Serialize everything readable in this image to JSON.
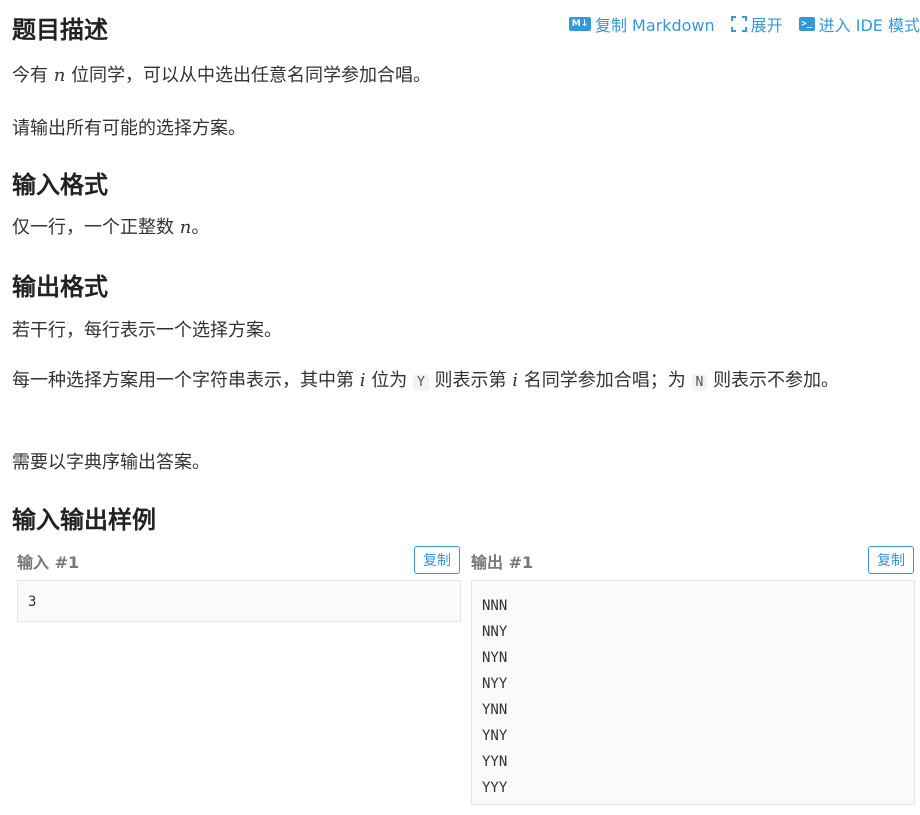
{
  "toolbar": {
    "copy_md": "复制 Markdown",
    "expand": "展开",
    "ide": "进入 IDE 模式",
    "md_icon": "M↓",
    "term_icon": ">_"
  },
  "sections": {
    "desc_title": "题目描述",
    "desc_p1_a": "今有",
    "desc_p1_var": "n",
    "desc_p1_b": "位同学，可以从中选出任意名同学参加合唱。",
    "desc_p2": "请输出所有可能的选择方案。",
    "input_title": "输入格式",
    "input_p_a": "仅一行，一个正整数",
    "input_p_var": "n",
    "input_p_b": "。",
    "output_title": "输出格式",
    "output_p1": "若干行，每行表示一个选择方案。",
    "output_p2_a": "每一种选择方案用一个字符串表示，其中第",
    "output_p2_var1": "i",
    "output_p2_b": "位为",
    "output_p2_code1": "Y",
    "output_p2_c": "则表示第",
    "output_p2_var2": "i",
    "output_p2_d": "名同学参加合唱；为",
    "output_p2_code2": "N",
    "output_p2_e": "则表示不参加。",
    "output_p3": "需要以字典序输出答案。",
    "sample_title": "输入输出样例"
  },
  "samples": {
    "input_label": "输入 #1",
    "output_label": "输出 #1",
    "copy_label": "复制",
    "input_content": "3",
    "output_lines": [
      "NNN",
      "NNY",
      "NYN",
      "NYY",
      "YNN",
      "YNY",
      "YYN",
      "YYY"
    ]
  }
}
